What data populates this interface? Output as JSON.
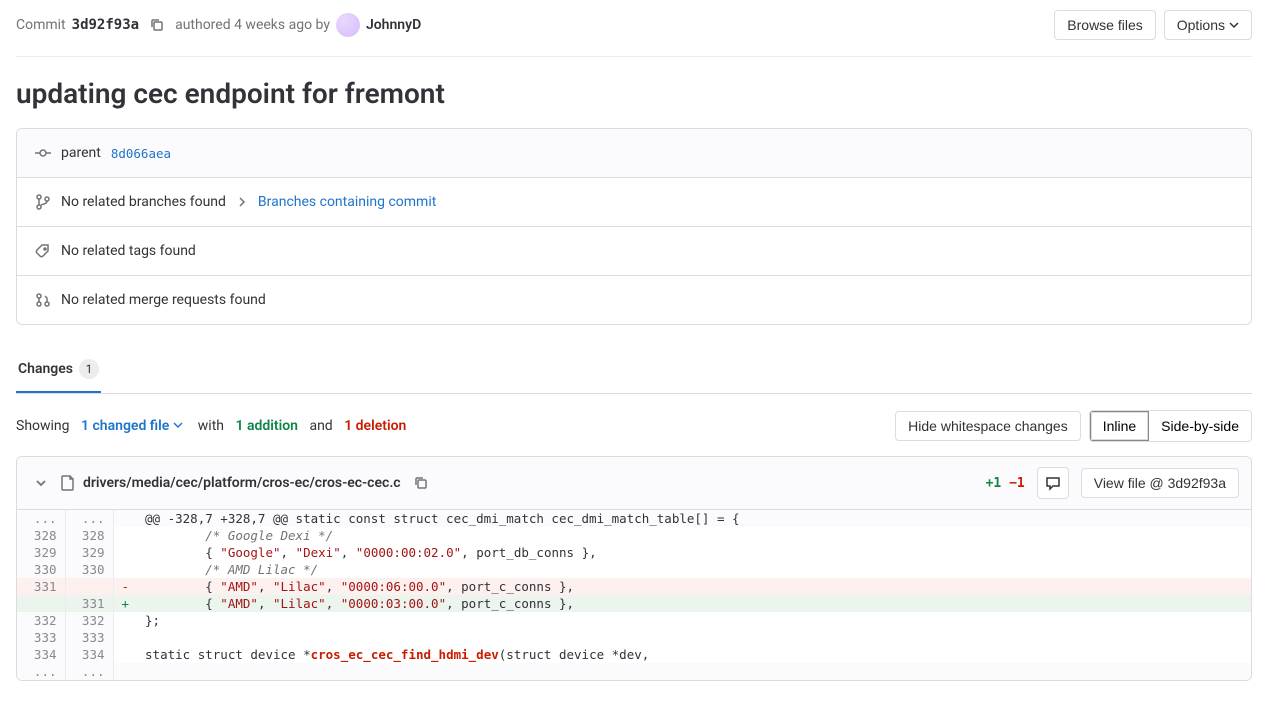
{
  "header": {
    "commit_label": "Commit",
    "commit_hash": "3d92f93a",
    "authored_text": "authored 4 weeks ago by",
    "author_name": "JohnnyD",
    "browse_label": "Browse files",
    "options_label": "Options"
  },
  "title": "updating cec endpoint for fremont",
  "meta": {
    "parent_label": "parent",
    "parent_hash": "8d066aea",
    "branches_text": "No related branches found",
    "branches_link": "Branches containing commit",
    "tags_text": "No related tags found",
    "mr_text": "No related merge requests found"
  },
  "tabs": {
    "changes_label": "Changes",
    "changes_count": "1"
  },
  "summary": {
    "showing": "Showing",
    "changed_file": "1 changed file",
    "with": "with",
    "addition": "1 addition",
    "and": "and",
    "deletion": "1 deletion",
    "hide_ws": "Hide whitespace changes",
    "inline": "Inline",
    "sbs": "Side-by-side"
  },
  "diff": {
    "path": "drivers/media/cec/platform/cros-ec/cros-ec-cec.c",
    "plus": "+1",
    "minus": "−1",
    "view_label": "View file @ 3d92f93a",
    "hunk": "@@ -328,7 +328,7 @@ static const struct cec_dmi_match cec_dmi_match_table[] = {",
    "rows": [
      {
        "o": "328",
        "n": "328",
        "type": "ctx",
        "content": "        /* Google Dexi */",
        "class": "s-gray"
      },
      {
        "o": "329",
        "n": "329",
        "type": "ctx",
        "html": "        { <span class='s-red'>\"Google\"</span>, <span class='s-red'>\"Dexi\"</span>, <span class='s-red'>\"0000:00:02.0\"</span>, port_db_conns },"
      },
      {
        "o": "330",
        "n": "330",
        "type": "ctx",
        "content": "        /* AMD Lilac */",
        "class": "s-gray"
      },
      {
        "o": "331",
        "n": "",
        "type": "del",
        "html": "        { <span class='s-red'>\"AMD\"</span>, <span class='s-red'>\"Lilac\"</span>, <span class='s-red'>\"0000:06:00.0\"</span>, port_c_conns },"
      },
      {
        "o": "",
        "n": "331",
        "type": "add",
        "html": "        { <span class='s-red'>\"AMD\"</span>, <span class='s-red'>\"Lilac\"</span>, <span class='s-red'>\"0000:03:00.0\"</span>, port_c_conns },"
      },
      {
        "o": "332",
        "n": "332",
        "type": "ctx",
        "content": "};"
      },
      {
        "o": "333",
        "n": "333",
        "type": "ctx",
        "content": ""
      },
      {
        "o": "334",
        "n": "334",
        "type": "ctx",
        "html": "static struct device *<span class='s-fn'>cros_ec_cec_find_hdmi_dev</span>(struct device *dev,"
      }
    ]
  }
}
